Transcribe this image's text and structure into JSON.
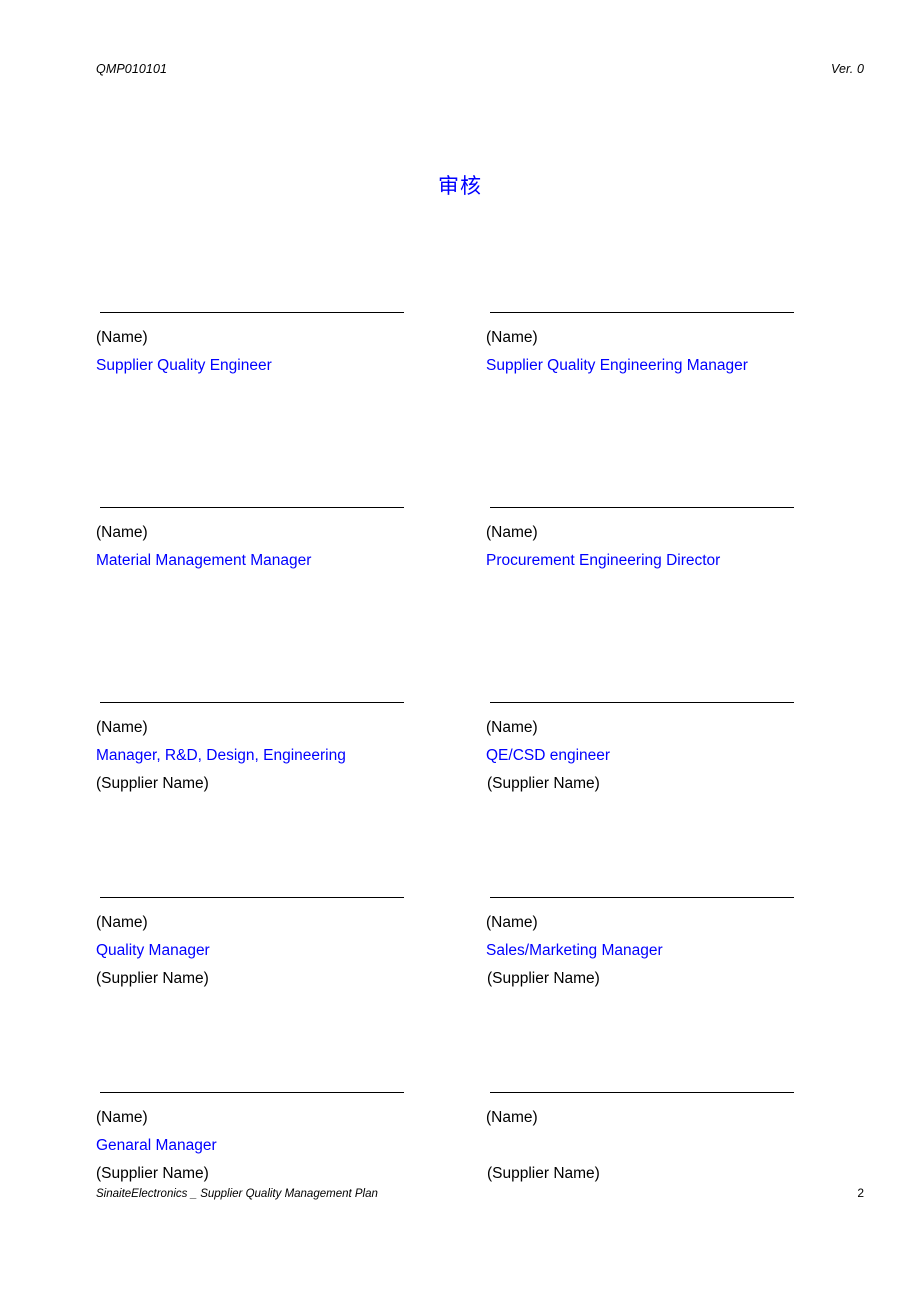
{
  "header": {
    "doc_code": "QMP010101",
    "version": "Ver. 0"
  },
  "title": "审核",
  "footer": {
    "text": "SinaiteElectronics _ Supplier Quality Management Plan",
    "page_number": "2"
  },
  "labels": {
    "name": "(Name)",
    "supplier_name": "(Supplier Name)"
  },
  "colors": {
    "role_blue": "#0000ff",
    "text_black": "#000000",
    "rule": "#000000"
  },
  "signature_blocks": [
    {
      "column": "left",
      "row": 1,
      "name_label": "(Name)",
      "role": "Supplier Quality Engineer",
      "supplier_label": ""
    },
    {
      "column": "right",
      "row": 1,
      "name_label": "(Name)",
      "role": "Supplier Quality Engineering Manager",
      "supplier_label": ""
    },
    {
      "column": "left",
      "row": 2,
      "name_label": "(Name)",
      "role": "Material Management Manager",
      "supplier_label": ""
    },
    {
      "column": "right",
      "row": 2,
      "name_label": "(Name)",
      "role": "Procurement Engineering Director",
      "supplier_label": ""
    },
    {
      "column": "left",
      "row": 3,
      "name_label": "(Name)",
      "role": "Manager, R&D, Design, Engineering",
      "supplier_label": "(Supplier Name)"
    },
    {
      "column": "right",
      "row": 3,
      "name_label": "(Name)",
      "role": "QE/CSD engineer",
      "supplier_label": "(Supplier Name)"
    },
    {
      "column": "left",
      "row": 4,
      "name_label": "(Name)",
      "role": "Quality Manager",
      "supplier_label": "(Supplier Name)"
    },
    {
      "column": "right",
      "row": 4,
      "name_label": "(Name)",
      "role": "Sales/Marketing Manager",
      "supplier_label": "(Supplier Name)"
    },
    {
      "column": "left",
      "row": 5,
      "name_label": "(Name)",
      "role": "Genaral Manager",
      "supplier_label": "(Supplier Name)"
    },
    {
      "column": "right",
      "row": 5,
      "name_label": "(Name)",
      "role": "",
      "supplier_label": "(Supplier Name)"
    }
  ]
}
